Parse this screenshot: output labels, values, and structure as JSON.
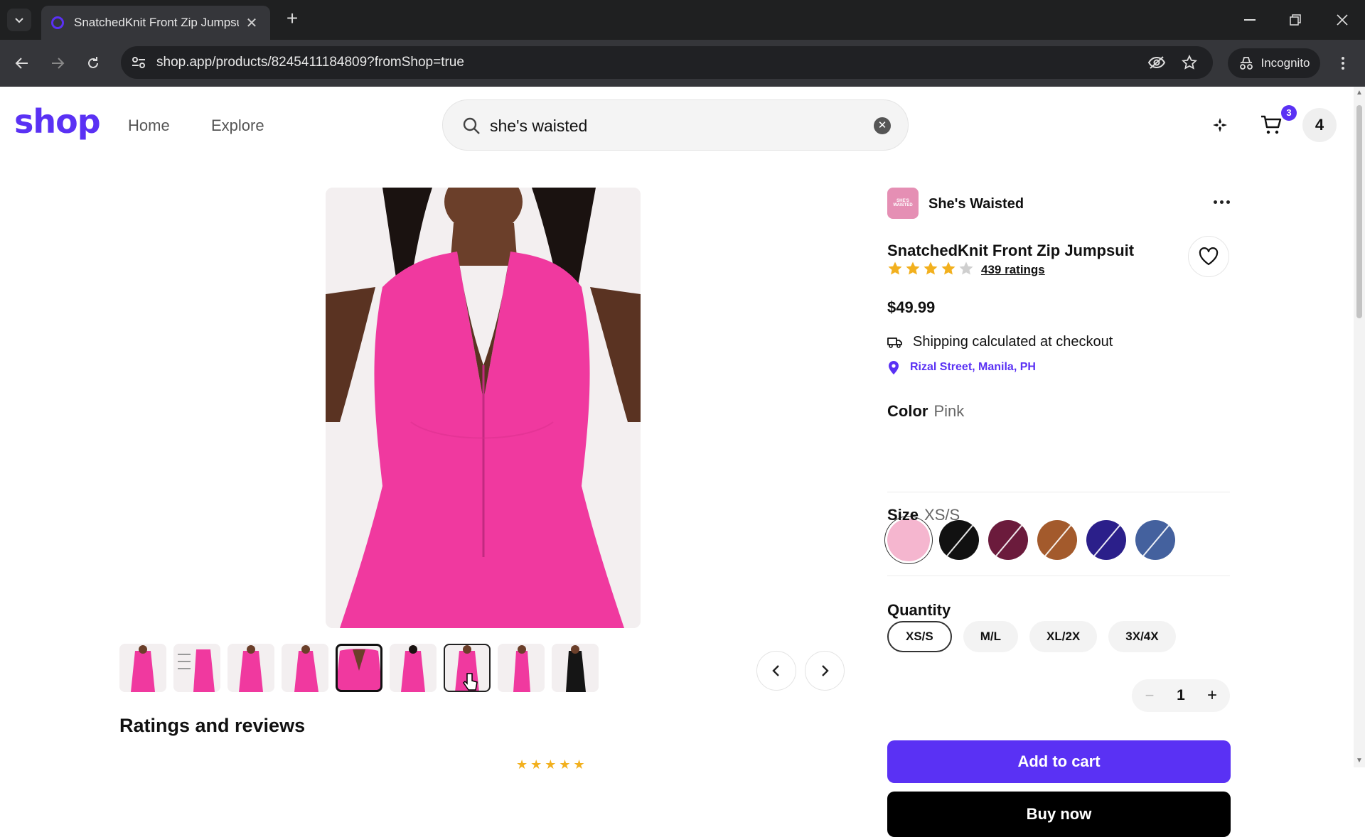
{
  "browser": {
    "tab_title": "SnatchedKnit Front Zip Jumpsuit",
    "url": "shop.app/products/8245411184809?fromShop=true",
    "incognito_label": "Incognito"
  },
  "header": {
    "logo": "shop",
    "nav": [
      "Home",
      "Explore"
    ],
    "search_value": "she's waisted",
    "cart_count": "3",
    "account_initial": "4"
  },
  "product": {
    "shop_name": "She's Waisted",
    "shop_logo_text": "SHE'S WAISTED",
    "title": "SnatchedKnit Front Zip Jumpsuit",
    "rating": 4,
    "ratings_text": "439 ratings",
    "price": "$49.99",
    "shipping_text": "Shipping calculated at checkout",
    "location_text": "Rizal Street, Manila, PH",
    "color_label": "Color",
    "color_value": "Pink",
    "colors": [
      {
        "name": "Pink",
        "hex": "#f5b6cf",
        "selected": true
      },
      {
        "name": "Black",
        "hex": "#111111",
        "selected": false
      },
      {
        "name": "Burgundy",
        "hex": "#6b1b3c",
        "selected": false
      },
      {
        "name": "Brown",
        "hex": "#a35a2c",
        "selected": false
      },
      {
        "name": "Navy",
        "hex": "#2b1f8a",
        "selected": false
      },
      {
        "name": "Blue",
        "hex": "#44619e",
        "selected": false
      }
    ],
    "size_label": "Size",
    "size_value": "XS/S",
    "sizes": [
      "XS/S",
      "M/L",
      "XL/2X",
      "3X/4X"
    ],
    "quantity_label": "Quantity",
    "quantity": "1",
    "add_to_cart": "Add to cart",
    "buy_now": "Buy now"
  },
  "gallery": {
    "thumbnail_count": 9,
    "selected_index": 4,
    "hovered_index": 6
  },
  "reviews": {
    "section_title": "Ratings and reviews"
  },
  "colors": {
    "brand": "#5a31f4",
    "star": "#f2b01e"
  }
}
